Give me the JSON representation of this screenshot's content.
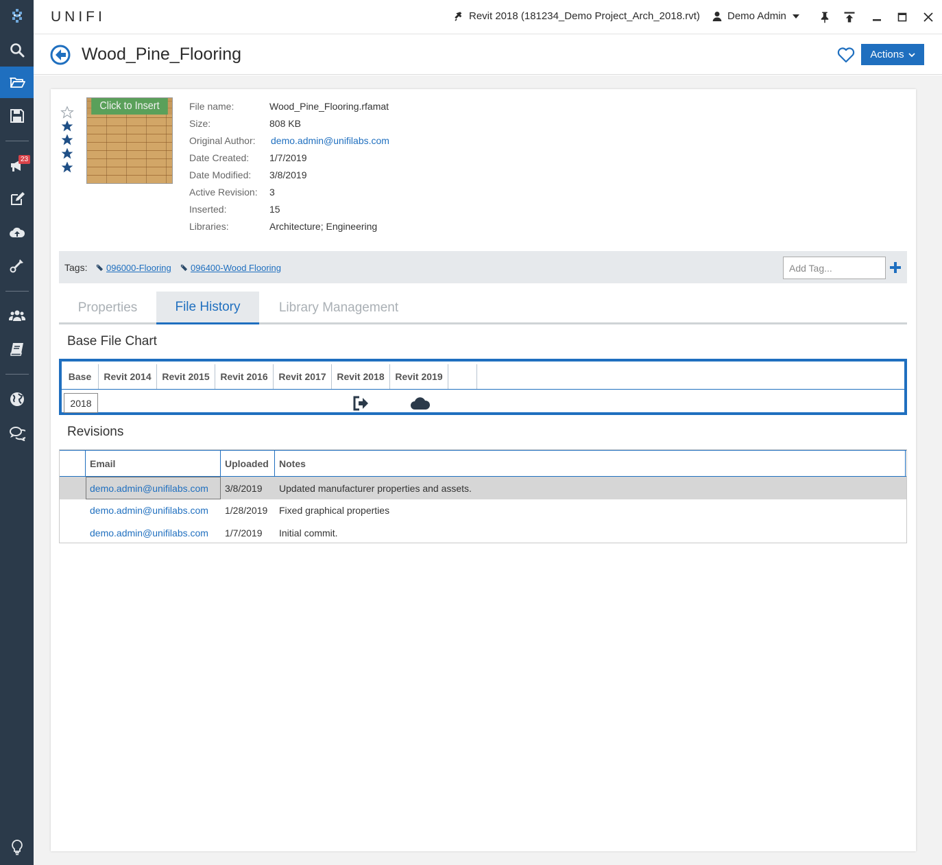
{
  "app": {
    "brand": "UNIFI",
    "project": "Revit 2018 (181234_Demo Project_Arch_2018.rvt)",
    "user": "Demo Admin"
  },
  "sidebar": {
    "notifications_count": "23",
    "items": [
      "search-icon",
      "folder-open-icon",
      "save-icon",
      "megaphone-icon",
      "edit-icon",
      "cloud-upload-icon",
      "tools-icon",
      "users-icon",
      "book-icon",
      "globe-icon",
      "comments-icon",
      "lightbulb-icon"
    ]
  },
  "header": {
    "title": "Wood_Pine_Flooring",
    "actions_label": "Actions"
  },
  "file": {
    "thumbnail_label": "Click to Insert",
    "rating": 4,
    "rating_max": 5,
    "details": [
      {
        "label": "File name:",
        "value": "Wood_Pine_Flooring.rfamat",
        "link": false
      },
      {
        "label": "Size:",
        "value": "808 KB",
        "link": false
      },
      {
        "label": "Original Author:",
        "value": "demo.admin@unifilabs.com",
        "link": true
      },
      {
        "label": "Date Created:",
        "value": "1/7/2019",
        "link": false
      },
      {
        "label": "Date Modified:",
        "value": "3/8/2019",
        "link": false
      },
      {
        "label": "Active Revision:",
        "value": "3",
        "link": false
      },
      {
        "label": "Inserted:",
        "value": "15",
        "link": false
      },
      {
        "label": "Libraries:",
        "value": "Architecture; Engineering",
        "link": false
      }
    ]
  },
  "tags": {
    "label": "Tags:",
    "items": [
      "096000-Flooring",
      "096400-Wood Flooring"
    ],
    "add_placeholder": "Add Tag..."
  },
  "tabs": [
    {
      "label": "Properties",
      "active": false
    },
    {
      "label": "File History",
      "active": true
    },
    {
      "label": "Library Management",
      "active": false
    }
  ],
  "base_chart": {
    "title": "Base File Chart",
    "columns": [
      "Base",
      "Revit 2014",
      "Revit 2015",
      "Revit 2016",
      "Revit 2017",
      "Revit 2018",
      "Revit 2019",
      ""
    ],
    "base_value": "2018",
    "icons": {
      "Revit 2018": "sign-out-icon",
      "Revit 2019": "cloud-icon"
    }
  },
  "revisions": {
    "title": "Revisions",
    "columns": [
      "",
      "Email",
      "Uploaded",
      "Notes"
    ],
    "rows": [
      {
        "email": "demo.admin@unifilabs.com",
        "uploaded": "3/8/2019",
        "notes": "Updated manufacturer properties and assets.",
        "selected": true
      },
      {
        "email": "demo.admin@unifilabs.com",
        "uploaded": "1/28/2019",
        "notes": "Fixed graphical properties",
        "selected": false
      },
      {
        "email": "demo.admin@unifilabs.com",
        "uploaded": "1/7/2019",
        "notes": "Initial commit.",
        "selected": false
      }
    ]
  },
  "colors": {
    "accent": "#1f6fbf",
    "sidebar": "#2b3a4a",
    "badge": "#d9434a"
  }
}
